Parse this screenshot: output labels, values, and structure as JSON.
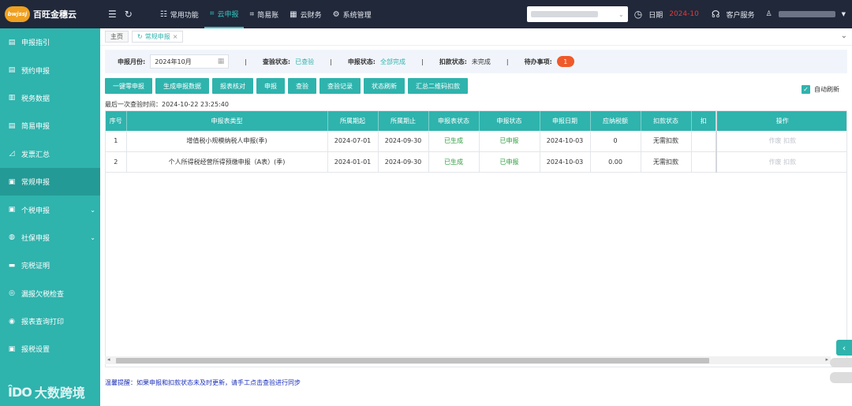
{
  "brand": {
    "logo_text": "bwjssj",
    "name": "百旺金穗云"
  },
  "topnav": {
    "items": [
      {
        "label": "常用功能",
        "icon": "sliders-icon",
        "active": false
      },
      {
        "label": "云申报",
        "icon": "crop-icon",
        "active": true
      },
      {
        "label": "简易账",
        "icon": "crop-icon",
        "active": false
      },
      {
        "label": "云财务",
        "icon": "grid-icon",
        "active": false
      },
      {
        "label": "系统管理",
        "icon": "gear-icon",
        "active": false
      }
    ]
  },
  "header_right": {
    "date_label": "日期",
    "date_value": "2024-10",
    "service_label": "客户服务"
  },
  "sidebar": {
    "items": [
      {
        "label": "申报指引",
        "icon": "doc-icon"
      },
      {
        "label": "预约申报",
        "icon": "doc-icon"
      },
      {
        "label": "税务数据",
        "icon": "book-icon"
      },
      {
        "label": "简易申报",
        "icon": "doc-icon"
      },
      {
        "label": "发票汇总",
        "icon": "chart-icon"
      },
      {
        "label": "常规申报",
        "icon": "monitor-icon"
      },
      {
        "label": "个税申报",
        "icon": "monitor-icon"
      },
      {
        "label": "社保申报",
        "icon": "shield-icon"
      },
      {
        "label": "完税证明",
        "icon": "card-icon"
      },
      {
        "label": "漏报欠税检查",
        "icon": "search-icon"
      },
      {
        "label": "报表查询打印",
        "icon": "print-icon"
      },
      {
        "label": "报税设置",
        "icon": "settings-icon"
      }
    ],
    "watermark": {
      "logo": "ÎDO",
      "text": "大数跨境"
    }
  },
  "tabs": [
    {
      "label": "主页",
      "active": false
    },
    {
      "label": "常规申报",
      "active": true
    }
  ],
  "filters": {
    "month_label": "申报月份:",
    "month_value": "2024年10月",
    "check_label": "查验状态:",
    "check_value": "已查验",
    "declare_label": "申报状态:",
    "declare_value": "全部完成",
    "deduct_label": "扣款状态:",
    "deduct_value": "未完成",
    "todo_label": "待办事项:",
    "todo_count": "1"
  },
  "actions": [
    "一键零申报",
    "生成申报数据",
    "报表核对",
    "申报",
    "查验",
    "查验记录",
    "状态刷新",
    "汇总二维码扣款"
  ],
  "auto_refresh": {
    "label": "自动刷新",
    "checked": true
  },
  "last_check": "最后一次查验时间：2024-10-22 23:25:40",
  "table": {
    "headers": [
      "序号",
      "申报表类型",
      "所属期起",
      "所属期止",
      "申报表状态",
      "申报状态",
      "申报日期",
      "应纳税额",
      "扣款状态",
      "扣",
      "操作"
    ],
    "rows": [
      {
        "no": "1",
        "type": "增值税小规模纳税人申报(季)",
        "start": "2024-07-01",
        "end": "2024-09-30",
        "form_status": "已生成",
        "declare_status": "已申报",
        "date": "2024-10-03",
        "tax": "0",
        "deduct_status": "无需扣款",
        "extra": "",
        "op_void": "作废",
        "op_deduct": "扣款"
      },
      {
        "no": "2",
        "type": "个人所得税经营所得预缴申报（A表）(季)",
        "start": "2024-01-01",
        "end": "2024-09-30",
        "form_status": "已生成",
        "declare_status": "已申报",
        "date": "2024-10-03",
        "tax": "0.00",
        "deduct_status": "无需扣款",
        "extra": "",
        "op_void": "作废",
        "op_deduct": "扣款"
      }
    ]
  },
  "tip": "温馨提醒：如果申报和扣款状态未及时更新，请手工点击查验进行同步"
}
